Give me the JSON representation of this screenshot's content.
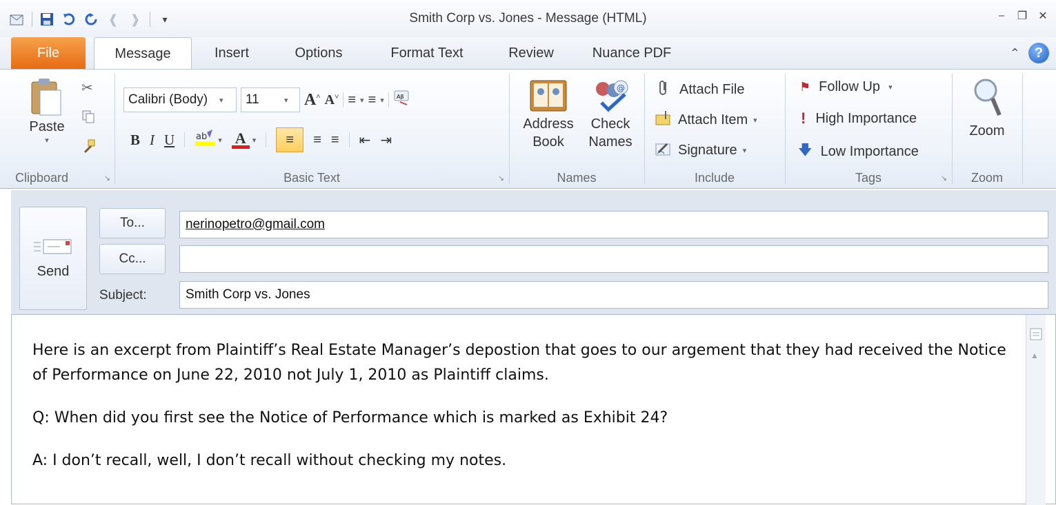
{
  "window": {
    "title": "Smith Corp vs. Jones - Message (HTML)"
  },
  "tabs": [
    {
      "label": "File"
    },
    {
      "label": "Message"
    },
    {
      "label": "Insert"
    },
    {
      "label": "Options"
    },
    {
      "label": "Format Text"
    },
    {
      "label": "Review"
    },
    {
      "label": "Nuance PDF"
    }
  ],
  "ribbon": {
    "clipboard": {
      "group_label": "Clipboard",
      "paste_label": "Paste"
    },
    "basic_text": {
      "group_label": "Basic Text",
      "font_name": "Calibri (Body)",
      "font_size": "11",
      "bold": "B",
      "italic": "I",
      "underline": "U",
      "font_color_glyph": "A"
    },
    "names": {
      "group_label": "Names",
      "address_book_label": "Address Book",
      "address_line1": "Address",
      "address_line2": "Book",
      "check_names_line1": "Check",
      "check_names_line2": "Names"
    },
    "include": {
      "group_label": "Include",
      "attach_file": "Attach File",
      "attach_item": "Attach Item",
      "signature": "Signature"
    },
    "tags": {
      "group_label": "Tags",
      "follow_up": "Follow Up",
      "high_importance": "High Importance",
      "low_importance": "Low Importance"
    },
    "zoom": {
      "group_label": "Zoom",
      "zoom_label": "Zoom"
    }
  },
  "compose": {
    "send_label": "Send",
    "to_button": "To...",
    "cc_button": "Cc...",
    "subject_label": "Subject:",
    "to_value": "nerinopetro@gmail.com",
    "cc_value": "",
    "subject_value": "Smith Corp vs. Jones"
  },
  "body": {
    "paragraphs": [
      "Here is an excerpt from Plaintiff’s Real Estate Manager’s depostion that goes to our argement that they had received the Notice of Performance on June 22, 2010 not July 1, 2010 as Plaintiff claims.",
      "Q: When did you first see the Notice of Performance which is marked as Exhibit 24?",
      "A: I don’t recall, well, I don’t recall without checking my notes."
    ]
  },
  "colors": {
    "file_tab": "#e66b13",
    "accent_blue": "#1f5fbf"
  }
}
